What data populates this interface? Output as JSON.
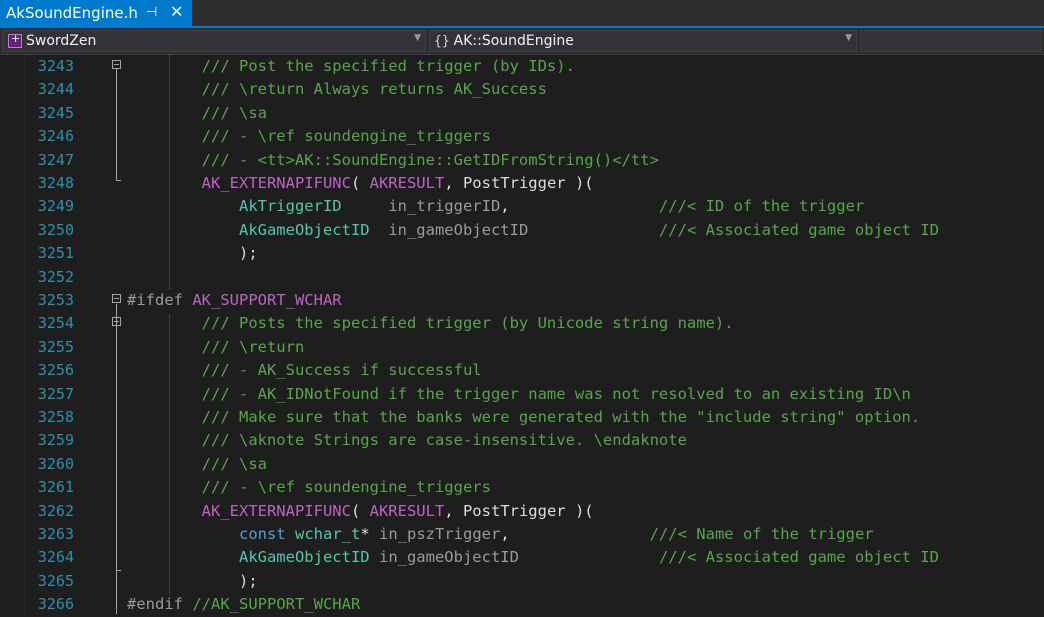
{
  "tab": {
    "title": "AkSoundEngine.h",
    "pin_icon": "pin-icon",
    "close_icon": "close-icon"
  },
  "navbar": {
    "project": "SwordZen",
    "scope_icon": "{}",
    "scope": "AK::SoundEngine",
    "member": ""
  },
  "colors": {
    "comment": "#57a64a",
    "macro": "#bd63c5",
    "type": "#4ec9b0",
    "keyword": "#569cd6",
    "line_number": "#2b91af",
    "accent": "#007acc"
  },
  "lines": [
    {
      "n": "3243",
      "fold": true,
      "tokens": [
        {
          "t": "comment",
          "v": "/// Post the specified trigger (by IDs)."
        }
      ],
      "indent": "        "
    },
    {
      "n": "3244",
      "tokens": [
        {
          "t": "comment",
          "v": "/// \\return Always returns AK_Success"
        }
      ],
      "indent": "        "
    },
    {
      "n": "3245",
      "tokens": [
        {
          "t": "comment",
          "v": "/// \\sa"
        }
      ],
      "indent": "        "
    },
    {
      "n": "3246",
      "tokens": [
        {
          "t": "comment",
          "v": "/// - \\ref soundengine_triggers"
        }
      ],
      "indent": "        "
    },
    {
      "n": "3247",
      "tokens": [
        {
          "t": "comment",
          "v": "/// - <tt>AK::SoundEngine::GetIDFromString()</tt>"
        }
      ],
      "indent": "        "
    },
    {
      "n": "3248",
      "tokens": [
        {
          "t": "macro",
          "v": "AK_EXTERNAPIFUNC"
        },
        {
          "t": "plain",
          "v": "( "
        },
        {
          "t": "macro",
          "v": "AKRESULT"
        },
        {
          "t": "plain",
          "v": ", PostTrigger )("
        }
      ],
      "indent": "        "
    },
    {
      "n": "3249",
      "tokens": [
        {
          "t": "type",
          "v": "AkTriggerID"
        },
        {
          "t": "plain",
          "v": "     "
        },
        {
          "t": "param",
          "v": "in_triggerID"
        },
        {
          "t": "plain",
          "v": ",                "
        },
        {
          "t": "comment",
          "v": "///< ID of the trigger"
        }
      ],
      "indent": "            "
    },
    {
      "n": "3250",
      "tokens": [
        {
          "t": "type",
          "v": "AkGameObjectID"
        },
        {
          "t": "plain",
          "v": "  "
        },
        {
          "t": "param",
          "v": "in_gameObjectID"
        },
        {
          "t": "plain",
          "v": "              "
        },
        {
          "t": "comment",
          "v": "///< Associated game object ID"
        }
      ],
      "indent": "            "
    },
    {
      "n": "3251",
      "tokens": [
        {
          "t": "plain",
          "v": ");"
        }
      ],
      "indent": "            "
    },
    {
      "n": "3252",
      "tokens": [],
      "indent": ""
    },
    {
      "n": "3253",
      "fold": true,
      "tokens": [
        {
          "t": "pre",
          "v": "#ifdef "
        },
        {
          "t": "macro",
          "v": "AK_SUPPORT_WCHAR"
        }
      ],
      "indent": ""
    },
    {
      "n": "3254",
      "fold": true,
      "tokens": [
        {
          "t": "comment",
          "v": "/// Posts the specified trigger (by Unicode string name)."
        }
      ],
      "indent": "        "
    },
    {
      "n": "3255",
      "tokens": [
        {
          "t": "comment",
          "v": "/// \\return"
        }
      ],
      "indent": "        "
    },
    {
      "n": "3256",
      "tokens": [
        {
          "t": "comment",
          "v": "/// - AK_Success if successful"
        }
      ],
      "indent": "        "
    },
    {
      "n": "3257",
      "tokens": [
        {
          "t": "comment",
          "v": "/// - AK_IDNotFound if the trigger name was not resolved to an existing ID\\n"
        }
      ],
      "indent": "        "
    },
    {
      "n": "3258",
      "tokens": [
        {
          "t": "comment",
          "v": "/// Make sure that the banks were generated with the \"include string\" option."
        }
      ],
      "indent": "        "
    },
    {
      "n": "3259",
      "tokens": [
        {
          "t": "comment",
          "v": "/// \\aknote Strings are case-insensitive. \\endaknote"
        }
      ],
      "indent": "        "
    },
    {
      "n": "3260",
      "tokens": [
        {
          "t": "comment",
          "v": "/// \\sa"
        }
      ],
      "indent": "        "
    },
    {
      "n": "3261",
      "tokens": [
        {
          "t": "comment",
          "v": "/// - \\ref soundengine_triggers"
        }
      ],
      "indent": "        "
    },
    {
      "n": "3262",
      "tokens": [
        {
          "t": "macro",
          "v": "AK_EXTERNAPIFUNC"
        },
        {
          "t": "plain",
          "v": "( "
        },
        {
          "t": "macro",
          "v": "AKRESULT"
        },
        {
          "t": "plain",
          "v": ", PostTrigger )("
        }
      ],
      "indent": "        "
    },
    {
      "n": "3263",
      "tokens": [
        {
          "t": "keyword",
          "v": "const"
        },
        {
          "t": "plain",
          "v": " "
        },
        {
          "t": "type",
          "v": "wchar_t"
        },
        {
          "t": "plain",
          "v": "* "
        },
        {
          "t": "param",
          "v": "in_pszTrigger"
        },
        {
          "t": "plain",
          "v": ",               "
        },
        {
          "t": "comment",
          "v": "///< Name of the trigger"
        }
      ],
      "indent": "            "
    },
    {
      "n": "3264",
      "tokens": [
        {
          "t": "type",
          "v": "AkGameObjectID"
        },
        {
          "t": "plain",
          "v": " "
        },
        {
          "t": "param",
          "v": "in_gameObjectID"
        },
        {
          "t": "plain",
          "v": "               "
        },
        {
          "t": "comment",
          "v": "///< Associated game object ID"
        }
      ],
      "indent": "            "
    },
    {
      "n": "3265",
      "tokens": [
        {
          "t": "plain",
          "v": ");"
        }
      ],
      "indent": "            "
    },
    {
      "n": "3266",
      "tokens": [
        {
          "t": "pre",
          "v": "#endif "
        },
        {
          "t": "comment",
          "v": "//AK_SUPPORT_WCHAR"
        }
      ],
      "indent": ""
    }
  ]
}
